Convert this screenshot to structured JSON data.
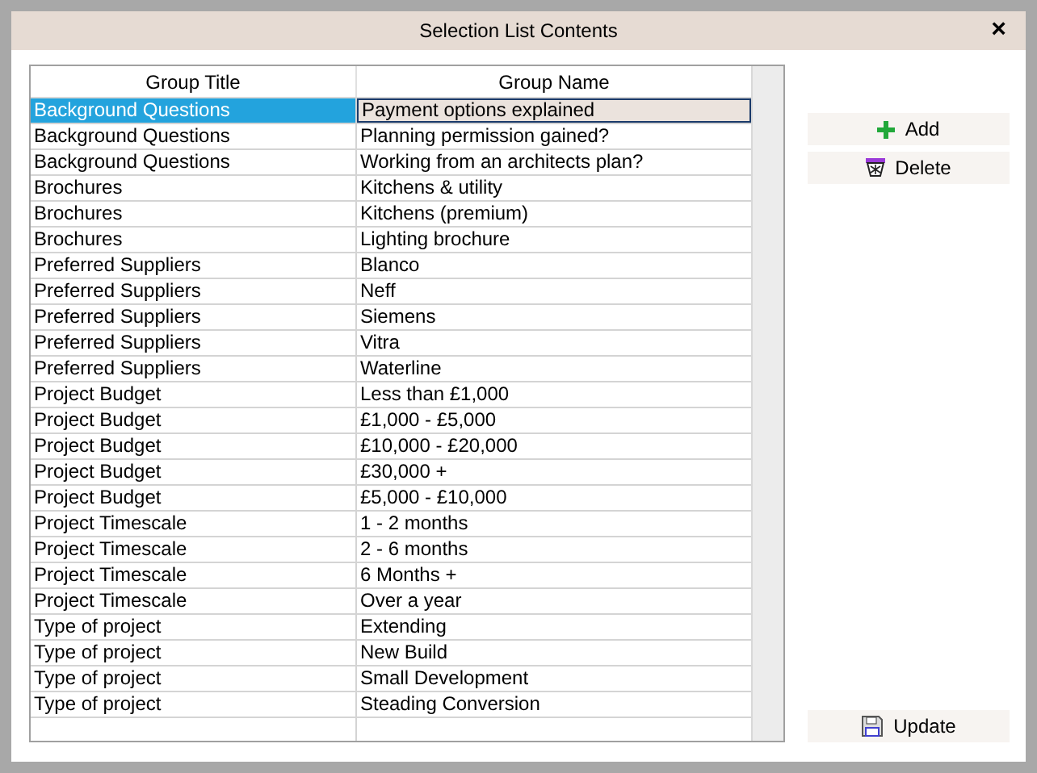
{
  "window": {
    "title": "Selection List Contents",
    "close": "×"
  },
  "table": {
    "columns": [
      "Group Title",
      "Group Name"
    ],
    "rows": [
      {
        "cells": [
          "Background Questions",
          "Payment options explained"
        ],
        "selected": true
      },
      {
        "cells": [
          "Background Questions",
          "Planning permission gained?"
        ],
        "selected": false
      },
      {
        "cells": [
          "Background Questions",
          "Working from an architects plan?"
        ],
        "selected": false
      },
      {
        "cells": [
          "Brochures",
          "Kitchens & utility"
        ],
        "selected": false
      },
      {
        "cells": [
          "Brochures",
          "Kitchens (premium)"
        ],
        "selected": false
      },
      {
        "cells": [
          "Brochures",
          "Lighting brochure"
        ],
        "selected": false
      },
      {
        "cells": [
          "Preferred Suppliers",
          "Blanco"
        ],
        "selected": false
      },
      {
        "cells": [
          "Preferred Suppliers",
          "Neff"
        ],
        "selected": false
      },
      {
        "cells": [
          "Preferred Suppliers",
          "Siemens"
        ],
        "selected": false
      },
      {
        "cells": [
          "Preferred Suppliers",
          "Vitra"
        ],
        "selected": false
      },
      {
        "cells": [
          "Preferred Suppliers",
          "Waterline"
        ],
        "selected": false
      },
      {
        "cells": [
          "Project Budget",
          "Less than £1,000"
        ],
        "selected": false
      },
      {
        "cells": [
          "Project Budget",
          "£1,000 - £5,000"
        ],
        "selected": false
      },
      {
        "cells": [
          "Project Budget",
          "£10,000 - £20,000"
        ],
        "selected": false
      },
      {
        "cells": [
          "Project Budget",
          "£30,000 +"
        ],
        "selected": false
      },
      {
        "cells": [
          "Project Budget",
          "£5,000 - £10,000"
        ],
        "selected": false
      },
      {
        "cells": [
          "Project Timescale",
          "1 - 2 months"
        ],
        "selected": false
      },
      {
        "cells": [
          "Project Timescale",
          "2 - 6 months"
        ],
        "selected": false
      },
      {
        "cells": [
          "Project Timescale",
          "6 Months +"
        ],
        "selected": false
      },
      {
        "cells": [
          "Project Timescale",
          "Over a year"
        ],
        "selected": false
      },
      {
        "cells": [
          "Type of project",
          "Extending"
        ],
        "selected": false
      },
      {
        "cells": [
          "Type of project",
          "New Build"
        ],
        "selected": false
      },
      {
        "cells": [
          "Type of project",
          "Small Development"
        ],
        "selected": false
      },
      {
        "cells": [
          "Type of project",
          "Steading Conversion"
        ],
        "selected": false
      }
    ]
  },
  "buttons": [
    {
      "label": "Add",
      "kind": "add"
    },
    {
      "label": "Delete",
      "kind": "delete"
    },
    {
      "label": "Update",
      "kind": "update"
    }
  ]
}
